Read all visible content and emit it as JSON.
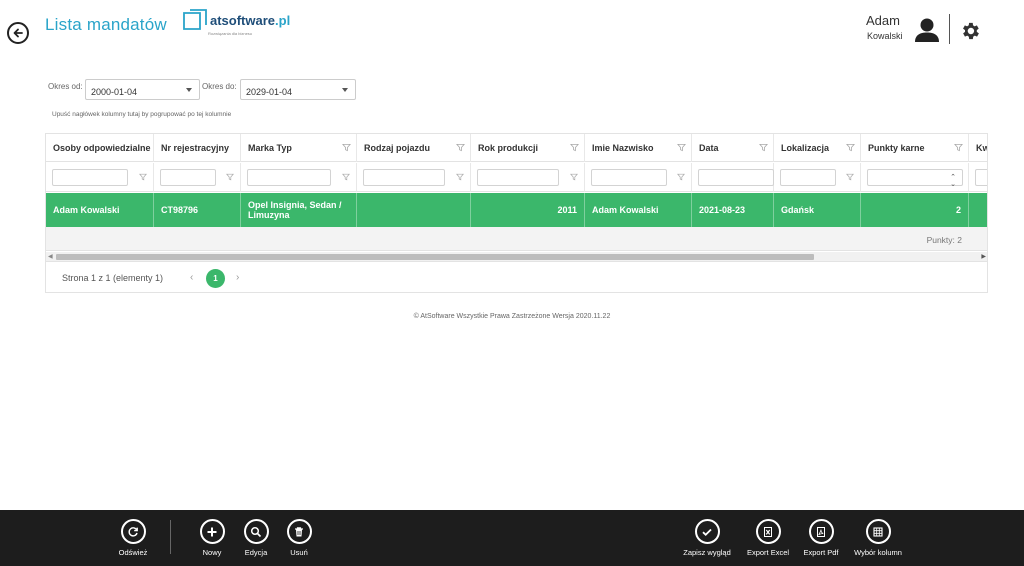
{
  "header": {
    "title": "Lista mandatów",
    "logo": {
      "name": "atsoftware",
      "ext": ".pl",
      "tagline": "Rozwiązania dla biznesu"
    },
    "user": {
      "first_name": "Adam",
      "last_name": "Kowalski"
    }
  },
  "filters": {
    "from_label": "Okres od:",
    "from_value": "2000-01-04",
    "to_label": "Okres do:",
    "to_value": "2029-01-04",
    "group_hint": "Upuść nagłówek kolumny tutaj by pogrupować po tej kolumnie"
  },
  "grid": {
    "columns": [
      "Osoby odpowiedzialne",
      "Nr rejestracyjny",
      "Marka Typ",
      "Rodzaj pojazdu",
      "Rok produkcji",
      "Imie Nazwisko",
      "Data",
      "Lokalizacja",
      "Punkty karne",
      "Kw"
    ],
    "rows": [
      {
        "osoby": "Adam Kowalski",
        "nr": "CT98796",
        "marka": "Opel Insignia, Sedan / Limuzyna",
        "rodzaj": "",
        "rok": "2011",
        "imie": "Adam Kowalski",
        "data": "2021-08-23",
        "lokalizacja": "Gdańsk",
        "punkty": "2",
        "kw": ""
      }
    ],
    "summary": "Punkty: 2",
    "pager": {
      "info": "Strona 1 z 1 (elementy 1)",
      "current_page": "1",
      "prev": "‹",
      "next": "›"
    }
  },
  "copyright": "© AtSoftware Wszystkie Prawa Zastrzeżone Wersja 2020.11.22",
  "toolbar": {
    "refresh": "Odśwież",
    "new": "Nowy",
    "edit": "Edycja",
    "delete": "Usuń",
    "save_layout": "Zapisz wygląd",
    "export_excel": "Export Excel",
    "export_pdf": "Export Pdf",
    "columns": "Wybór kolumn"
  },
  "colors": {
    "accent": "#2aa4c9",
    "row_selected": "#3bb76b",
    "toolbar_bg": "#1d1d1d"
  }
}
